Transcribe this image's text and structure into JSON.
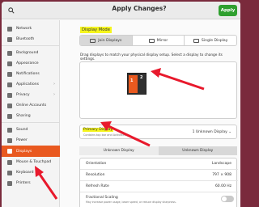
{
  "window": {
    "title": "Apply Changes?",
    "apply_label": "Apply"
  },
  "sidebar": {
    "items": [
      {
        "label": "Network"
      },
      {
        "label": "Bluetooth"
      },
      {
        "label": "Background"
      },
      {
        "label": "Appearance"
      },
      {
        "label": "Notifications"
      },
      {
        "label": "Applications"
      },
      {
        "label": "Privacy"
      },
      {
        "label": "Online Accounts"
      },
      {
        "label": "Sharing"
      },
      {
        "label": "Sound"
      },
      {
        "label": "Power"
      },
      {
        "label": "Displays"
      },
      {
        "label": "Mouse & Touchpad"
      },
      {
        "label": "Keyboard"
      },
      {
        "label": "Printers"
      }
    ],
    "active": "Displays"
  },
  "display_mode": {
    "heading": "Display Mode",
    "options": [
      "Join Displays",
      "Mirror",
      "Single Display"
    ],
    "selected": "Join Displays"
  },
  "arrangement": {
    "hint": "Drag displays to match your physical display setup. Select a display to change its settings.",
    "monitors": [
      "1",
      "2"
    ]
  },
  "primary_display": {
    "title": "Primary Display",
    "subtitle": "Contains top bar and Activities",
    "value": "1  Unknown Display"
  },
  "display_tabs": [
    "Unknown Display",
    "Unknown Display"
  ],
  "settings": {
    "orientation": {
      "label": "Orientation",
      "value": "Landscape"
    },
    "resolution": {
      "label": "Resolution",
      "value": "797 × 908"
    },
    "refresh_rate": {
      "label": "Refresh Rate",
      "value": "60.00 Hz"
    },
    "fractional_scaling": {
      "label": "Fractional Scaling",
      "subtitle": "May increase power usage, lower speed, or reduce display sharpness."
    }
  },
  "colors": {
    "accent": "#e9591f",
    "highlight": "#f5f51c",
    "arrow": "#e8192c",
    "apply": "#2fa02f"
  }
}
